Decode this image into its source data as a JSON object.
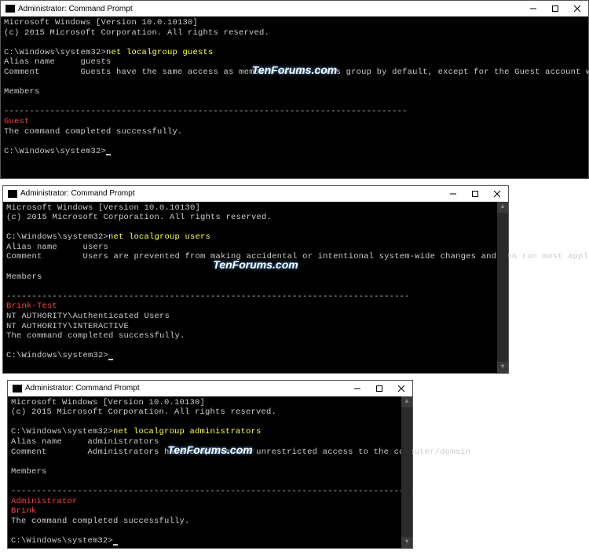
{
  "windows": [
    {
      "title": "Administrator: Command Prompt",
      "version": "Microsoft Windows [Version 10.0.10130]",
      "copyright": "(c) 2015 Microsoft Corporation. All rights reserved.",
      "prompt": "C:\\Windows\\system32>",
      "command": "net localgroup guests",
      "alias_label": "Alias name",
      "alias_value": "guests",
      "comment_label": "Comment",
      "comment_value": "Guests have the same access as members of the Users group by default, except for the Guest account which is further restricted",
      "members_label": "Members",
      "members": [
        "Guest"
      ],
      "other_lines": [],
      "success": "The command completed successfully.",
      "watermark": "TenForums.com"
    },
    {
      "title": "Administrator: Command Prompt",
      "version": "Microsoft Windows [Version 10.0.10130]",
      "copyright": "(c) 2015 Microsoft Corporation. All rights reserved.",
      "prompt": "C:\\Windows\\system32>",
      "command": "net localgroup users",
      "alias_label": "Alias name",
      "alias_value": "users",
      "comment_label": "Comment",
      "comment_value": "Users are prevented from making accidental or intentional system-wide changes and can run most applications",
      "members_label": "Members",
      "members": [
        "Brink-Test"
      ],
      "other_lines": [
        "NT AUTHORITY\\Authenticated Users",
        "NT AUTHORITY\\INTERACTIVE"
      ],
      "success": "The command completed successfully.",
      "watermark": "TenForums.com"
    },
    {
      "title": "Administrator: Command Prompt",
      "version": "Microsoft Windows [Version 10.0.10130]",
      "copyright": "(c) 2015 Microsoft Corporation. All rights reserved.",
      "prompt": "C:\\Windows\\system32>",
      "command": "net localgroup administrators",
      "alias_label": "Alias name",
      "alias_value": "administrators",
      "comment_label": "Comment",
      "comment_value": "Administrators have complete and unrestricted access to the computer/domain",
      "members_label": "Members",
      "members": [
        "Administrator",
        "Brink"
      ],
      "other_lines": [],
      "success": "The command completed successfully.",
      "watermark": "TenForums.com"
    }
  ],
  "dashline": "-------------------------------------------------------------------------------"
}
